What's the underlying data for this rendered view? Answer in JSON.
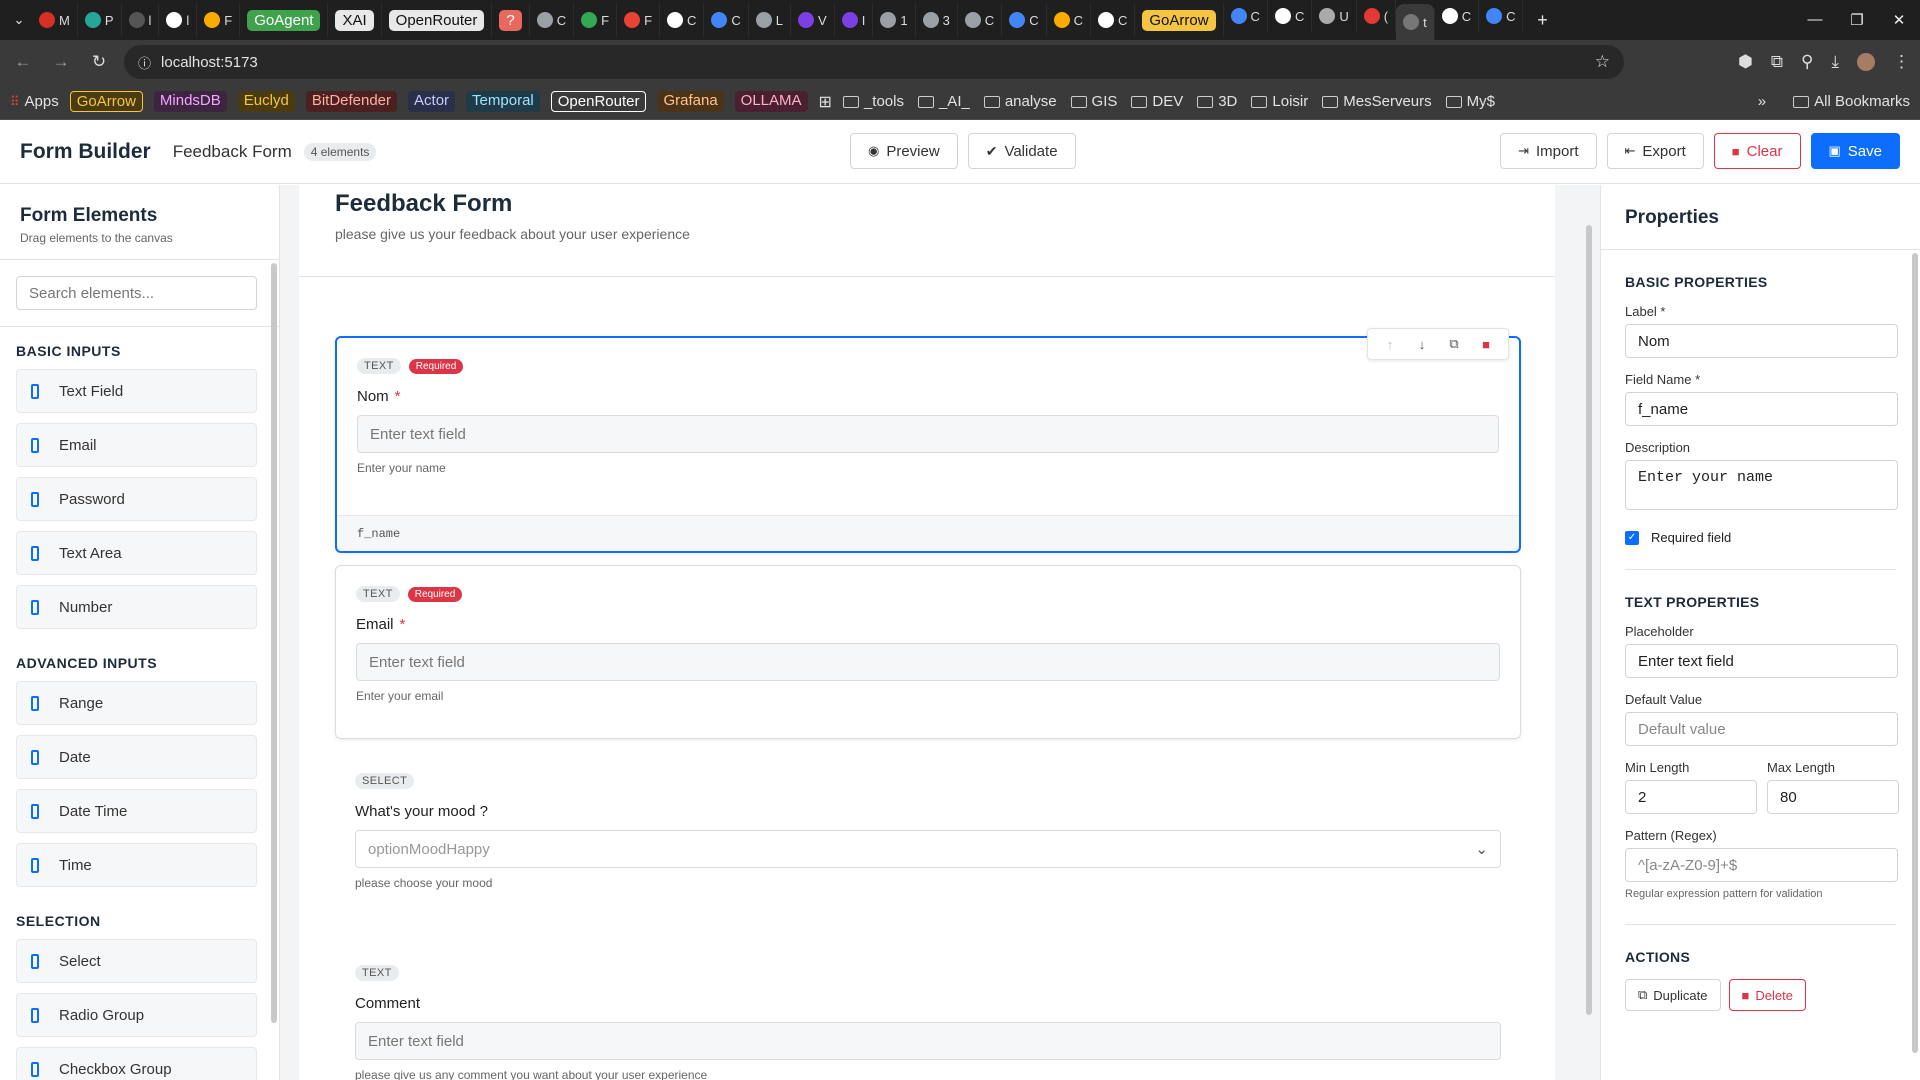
{
  "browser": {
    "tabs": [
      {
        "label": "M",
        "color": "#d93025"
      },
      {
        "label": "P",
        "color": "#26a69a"
      },
      {
        "label": "l",
        "color": "#555"
      },
      {
        "label": "l",
        "color": "#fff"
      },
      {
        "label": "F",
        "color": "#f9ab00"
      }
    ],
    "tab_badges": [
      {
        "label": "GoAgent",
        "bg": "#3fa34d",
        "fg": "#fff"
      },
      {
        "label": "XAI",
        "bg": "#e8e8e8",
        "fg": "#111"
      },
      {
        "label": "OpenRouter",
        "bg": "#e8e8e8",
        "fg": "#111"
      },
      {
        "label": "?",
        "bg": "#e8695e",
        "fg": "#fff"
      }
    ],
    "tabs2": [
      "C",
      "F",
      "F",
      "C",
      "C",
      "L",
      "V",
      "I",
      "1",
      "3",
      "C",
      "C",
      "C",
      "C"
    ],
    "tab_badge2": {
      "label": "GoArrow",
      "bg": "#f5c542",
      "fg": "#111"
    },
    "tabs3": [
      "C",
      "C",
      "U",
      "(",
      "t",
      "C",
      "C"
    ],
    "url": "localhost:5173",
    "bookmarks": [
      {
        "label": "Apps",
        "type": "plain"
      },
      {
        "label": "GoArrow",
        "type": "tag",
        "bg": "#4a3b10",
        "fg": "#f5c542",
        "border": "#f5c542"
      },
      {
        "label": "MindsDB",
        "type": "tag",
        "bg": "#3d2440",
        "fg": "#f0a8ff"
      },
      {
        "label": "Euclyd",
        "type": "tag",
        "bg": "#4a3b10",
        "fg": "#f5c542"
      },
      {
        "label": "BitDefender",
        "type": "tag",
        "bg": "#4a2020",
        "fg": "#ffb0a0"
      },
      {
        "label": "Actor",
        "type": "tag",
        "bg": "#2a2f4a",
        "fg": "#c6cbff"
      },
      {
        "label": "Temporal",
        "type": "tag",
        "bg": "#1f3a48",
        "fg": "#9fe4ff"
      },
      {
        "label": "OpenRouter",
        "type": "tag",
        "bg": "#3a3a3a",
        "fg": "#fff",
        "border": "#fff"
      },
      {
        "label": "Grafana",
        "type": "tag",
        "bg": "#4a3318",
        "fg": "#ffc48a"
      },
      {
        "label": "OLLAMA",
        "type": "tag",
        "bg": "#4a2030",
        "fg": "#ffb0c8"
      }
    ],
    "folders": [
      "_tools",
      "_AI_",
      "analyse",
      "GIS",
      "DEV",
      "3D",
      "Loisir",
      "MesServeurs",
      "My$"
    ],
    "all_bookmarks": "All Bookmarks"
  },
  "header": {
    "title": "Form Builder",
    "form_name": "Feedback Form",
    "element_count": "4 elements",
    "preview": "Preview",
    "validate": "Validate",
    "import": "Import",
    "export": "Export",
    "clear": "Clear",
    "save": "Save"
  },
  "sidebar": {
    "title": "Form Elements",
    "subtitle": "Drag elements to the canvas",
    "search_placeholder": "Search elements...",
    "sections": [
      {
        "title": "BASIC INPUTS",
        "items": [
          "Text Field",
          "Email",
          "Password",
          "Text Area",
          "Number"
        ]
      },
      {
        "title": "ADVANCED INPUTS",
        "items": [
          "Range",
          "Date",
          "Date Time",
          "Time"
        ]
      },
      {
        "title": "SELECTION",
        "items": [
          "Select",
          "Radio Group",
          "Checkbox Group"
        ]
      }
    ]
  },
  "canvas": {
    "title": "Feedback Form",
    "description": "please give us your feedback about your user experience",
    "fields": [
      {
        "type": "TEXT",
        "required_tag": "Required",
        "label": "Nom",
        "required": true,
        "placeholder": "Enter text field",
        "description": "Enter your name",
        "name": "f_name"
      },
      {
        "type": "TEXT",
        "required_tag": "Required",
        "label": "Email",
        "required": true,
        "placeholder": "Enter text field",
        "description": "Enter your email"
      },
      {
        "type": "SELECT",
        "label": "What's your mood ?",
        "placeholder": "optionMoodHappy",
        "description": "please choose your mood"
      },
      {
        "type": "TEXT",
        "label": "Comment",
        "placeholder": "Enter text field",
        "description": "please give us any comment you want about your user experience"
      }
    ]
  },
  "properties": {
    "title": "Properties",
    "basic_title": "BASIC PROPERTIES",
    "label_label": "Label *",
    "label_value": "Nom",
    "field_name_label": "Field Name *",
    "field_name_value": "f_name",
    "description_label": "Description",
    "description_value": "Enter your name",
    "required_label": "Required field",
    "text_title": "TEXT PROPERTIES",
    "placeholder_label": "Placeholder",
    "placeholder_value": "Enter text field",
    "default_label": "Default Value",
    "default_placeholder": "Default value",
    "min_label": "Min Length",
    "min_value": "2",
    "max_label": "Max Length",
    "max_value": "80",
    "pattern_label": "Pattern (Regex)",
    "pattern_placeholder": "^[a-zA-Z0-9]+$",
    "pattern_hint": "Regular expression pattern for validation",
    "actions_title": "ACTIONS",
    "duplicate": "Duplicate",
    "delete": "Delete"
  }
}
